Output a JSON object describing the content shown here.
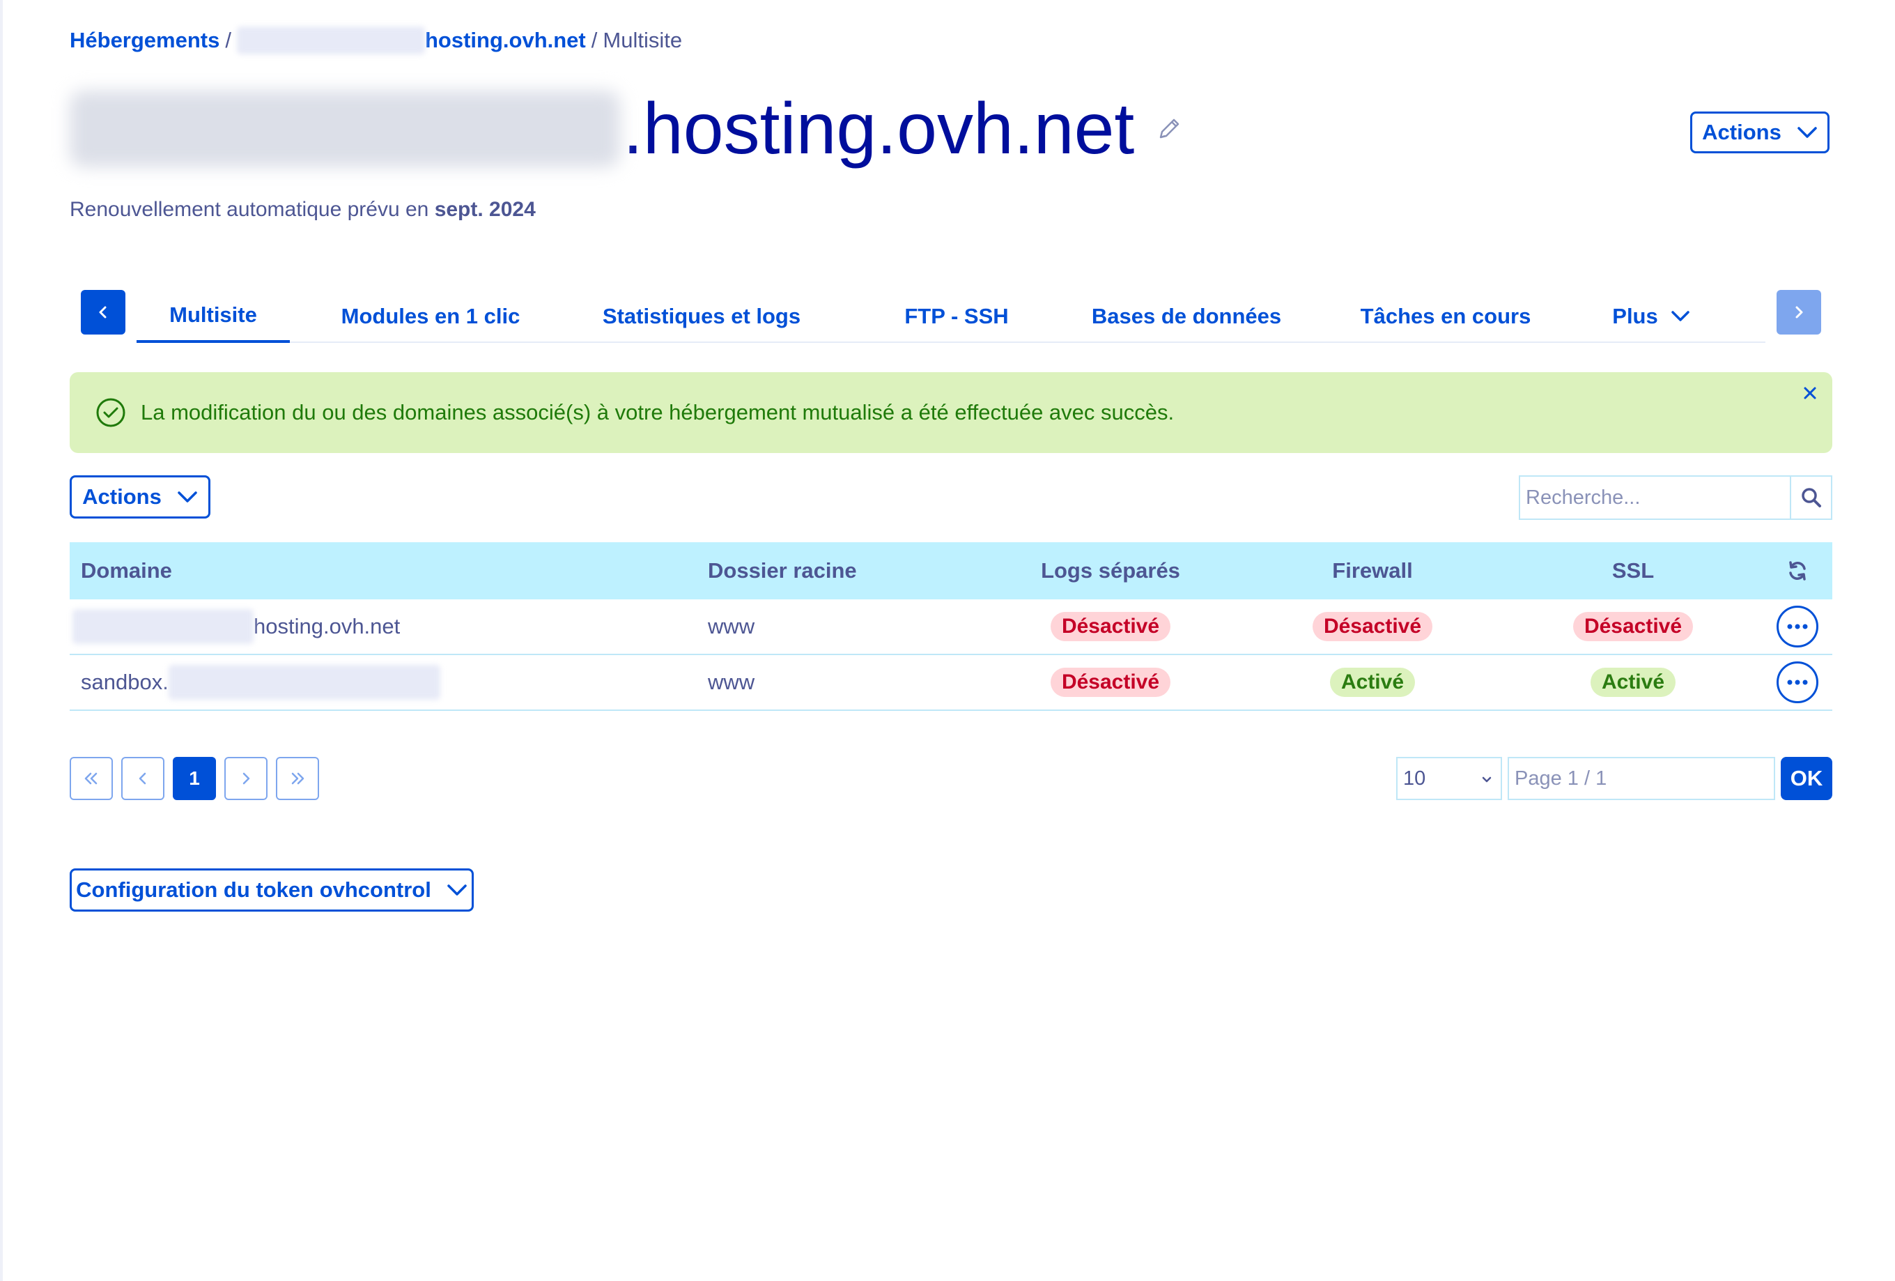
{
  "breadcrumb": {
    "root": "Hébergements",
    "separator": "/",
    "service_suffix": "hosting.ovh.net",
    "current": "Multisite"
  },
  "header": {
    "title_suffix": ".hosting.ovh.net",
    "actions_label": "Actions",
    "renewal_prefix": "Renouvellement automatique prévu en",
    "renewal_date": "sept. 2024"
  },
  "tabs": [
    {
      "label": "Multisite",
      "active": true
    },
    {
      "label": "Modules en 1 clic",
      "active": false
    },
    {
      "label": "Statistiques et logs",
      "active": false
    },
    {
      "label": "FTP - SSH",
      "active": false
    },
    {
      "label": "Bases de données",
      "active": false
    },
    {
      "label": "Tâches en cours",
      "active": false
    },
    {
      "label": "Plus",
      "active": false
    }
  ],
  "alert": {
    "message": "La modification du ou des domaines associé(s) à votre hébergement mutualisé a été effectuée avec succès."
  },
  "toolbar": {
    "actions_label": "Actions",
    "search_placeholder": "Recherche..."
  },
  "table": {
    "columns": {
      "domain": "Domaine",
      "root": "Dossier racine",
      "logs": "Logs séparés",
      "firewall": "Firewall",
      "ssl": "SSL"
    },
    "rows": [
      {
        "domain_visible": "hosting.ovh.net",
        "root": "www",
        "logs": "Désactivé",
        "firewall": "Désactivé",
        "ssl": "Désactivé"
      },
      {
        "domain_visible": "sandbox.",
        "root": "www",
        "logs": "Désactivé",
        "firewall": "Activé",
        "ssl": "Activé"
      }
    ]
  },
  "pagination": {
    "current_page": "1",
    "page_size": "10",
    "page_info": "Page 1 / 1",
    "ok_label": "OK"
  },
  "token": {
    "label": "Configuration du token ovhcontrol"
  },
  "colors": {
    "primary": "#0050d7",
    "title": "#000e9c",
    "text": "#4d5693",
    "table_header": "#bef1ff",
    "success_bg": "#dcf2bd",
    "success_text": "#1f7a0a",
    "danger_bg": "#ffd4d8",
    "danger_text": "#c40026"
  }
}
